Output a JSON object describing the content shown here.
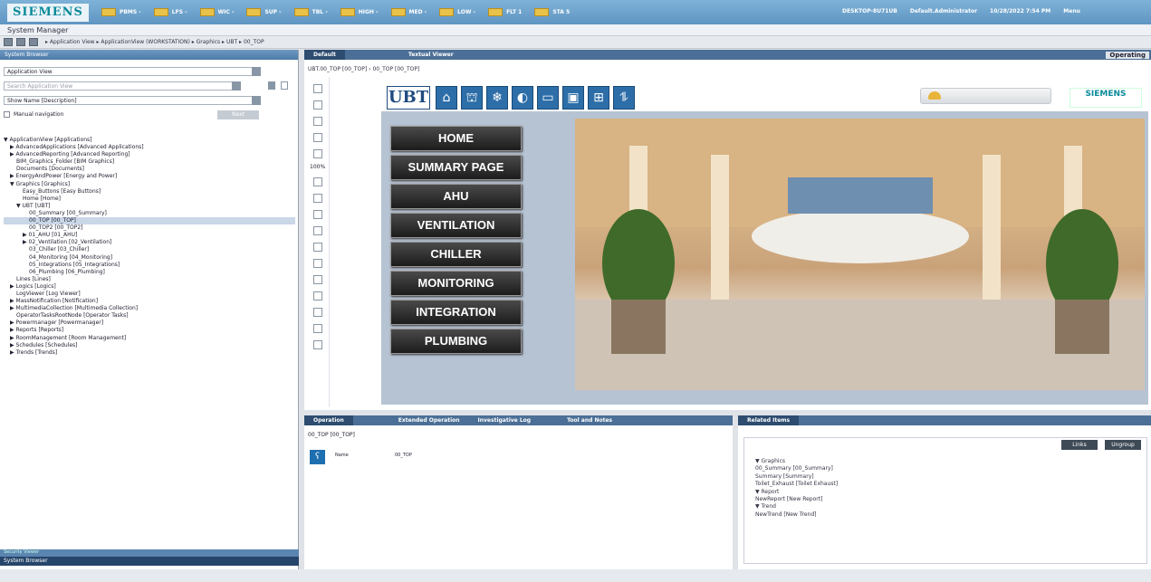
{
  "logo": "SIEMENS",
  "summary_tabs": [
    {
      "label": "PBMS -"
    },
    {
      "label": "LFS -"
    },
    {
      "label": "WIC -"
    },
    {
      "label": "SUP -"
    },
    {
      "label": "TBL -"
    },
    {
      "label": "HIGH -"
    },
    {
      "label": "MED -"
    },
    {
      "label": "LOW -"
    },
    {
      "label": "FLT 1"
    },
    {
      "label": "STA 5"
    }
  ],
  "user": {
    "host": "DESKTOP-8U71UB",
    "account": "Default.Administrator",
    "datetime": "10/28/2022 7:54 PM",
    "menu": "Menu"
  },
  "app_title": "System Manager",
  "breadcrumb": "▸ Application View ▸ ApplicationView (WORKSTATION) ▸ Graphics ▸ UBT ▸ 00_TOP",
  "left": {
    "header": "System Browser",
    "view_select": "Application View",
    "search_placeholder": "Search Application View",
    "name_select": "Show Name [Description]",
    "manual_nav": "Manual navigation",
    "go_label": "Next",
    "tree": [
      {
        "label": "▼ ApplicationView [Applications]",
        "indent": 0
      },
      {
        "label": "▶ AdvancedApplications [Advanced Applications]",
        "indent": 1
      },
      {
        "label": "▶ AdvancedReporting [Advanced Reporting]",
        "indent": 1
      },
      {
        "label": "BIM_Graphics_Folder [BIM Graphics]",
        "indent": 2
      },
      {
        "label": "Documents [Documents]",
        "indent": 2
      },
      {
        "label": "▶ EnergyAndPower [Energy and Power]",
        "indent": 1
      },
      {
        "label": "▼ Graphics [Graphics]",
        "indent": 1
      },
      {
        "label": "Easy_Buttons [Easy Buttons]",
        "indent": 3
      },
      {
        "label": "Home [Home]",
        "indent": 3
      },
      {
        "label": "▼ UBT [UBT]",
        "indent": 2
      },
      {
        "label": "00_Summary [00_Summary]",
        "indent": 4
      },
      {
        "label": "00_TOP [00_TOP]",
        "indent": 4,
        "hl": true
      },
      {
        "label": "00_TOP2 [00_TOP2]",
        "indent": 4
      },
      {
        "label": "▶ 01_AHU [01_AHU]",
        "indent": 3
      },
      {
        "label": "▶ 02_Ventilation [02_Ventilation]",
        "indent": 3
      },
      {
        "label": "03_Chiller [03_Chiller]",
        "indent": 4
      },
      {
        "label": "04_Monitoring [04_Monitoring]",
        "indent": 4
      },
      {
        "label": "05_Integrations [05_Integrations]",
        "indent": 4
      },
      {
        "label": "06_Plumbing [06_Plumbing]",
        "indent": 4
      },
      {
        "label": "Lines [Lines]",
        "indent": 2
      },
      {
        "label": "▶ Logics [Logics]",
        "indent": 1
      },
      {
        "label": "LogViewer [Log Viewer]",
        "indent": 2
      },
      {
        "label": "▶ MassNotification [Notification]",
        "indent": 1
      },
      {
        "label": "▶ MultimediaCollection [Multimedia Collection]",
        "indent": 1
      },
      {
        "label": "OperatorTasksRootNode [Operator Tasks]",
        "indent": 2
      },
      {
        "label": "▶ Powermanager [Powermanager]",
        "indent": 1
      },
      {
        "label": "▶ Reports [Reports]",
        "indent": 1
      },
      {
        "label": "▶ RoomManagement [Room Management]",
        "indent": 1
      },
      {
        "label": "▶ Schedules [Schedules]",
        "indent": 1
      },
      {
        "label": "▶ Trends [Trends]",
        "indent": 1
      }
    ],
    "footer1": "Security Viewer",
    "footer2": "System Browser"
  },
  "main": {
    "tabs": [
      "Default",
      "Textual Viewer"
    ],
    "mode": "Operating",
    "path": "UBT.00_TOP [00_TOP]  ›  00_TOP [00_TOP]",
    "zoom": "100%",
    "ubt": "UBT",
    "siemens_small": "SIEMENS",
    "nav": [
      "HOME",
      "SUMMARY PAGE",
      "AHU",
      "VENTILATION",
      "CHILLER",
      "MONITORING",
      "INTEGRATION",
      "PLUMBING"
    ]
  },
  "ops": {
    "tabs": [
      "Operation",
      "Extended Operation",
      "Investigative Log",
      "Tool and Notes"
    ],
    "title": "00_TOP [00_TOP]",
    "name_label": "Name",
    "name_value": "00_TOP"
  },
  "related": {
    "tab": "Related Items",
    "btn1": "Links",
    "btn2": "Ungroup",
    "items": [
      "▼  Graphics",
      "00_Summary [00_Summary]",
      "Summary [Summary]",
      "Toilet_Exhaust [Toilet Exhaust]",
      "▼  Report",
      "NewReport [New Report]",
      "▼  Trend",
      "NewTrend [New Trend]"
    ]
  }
}
